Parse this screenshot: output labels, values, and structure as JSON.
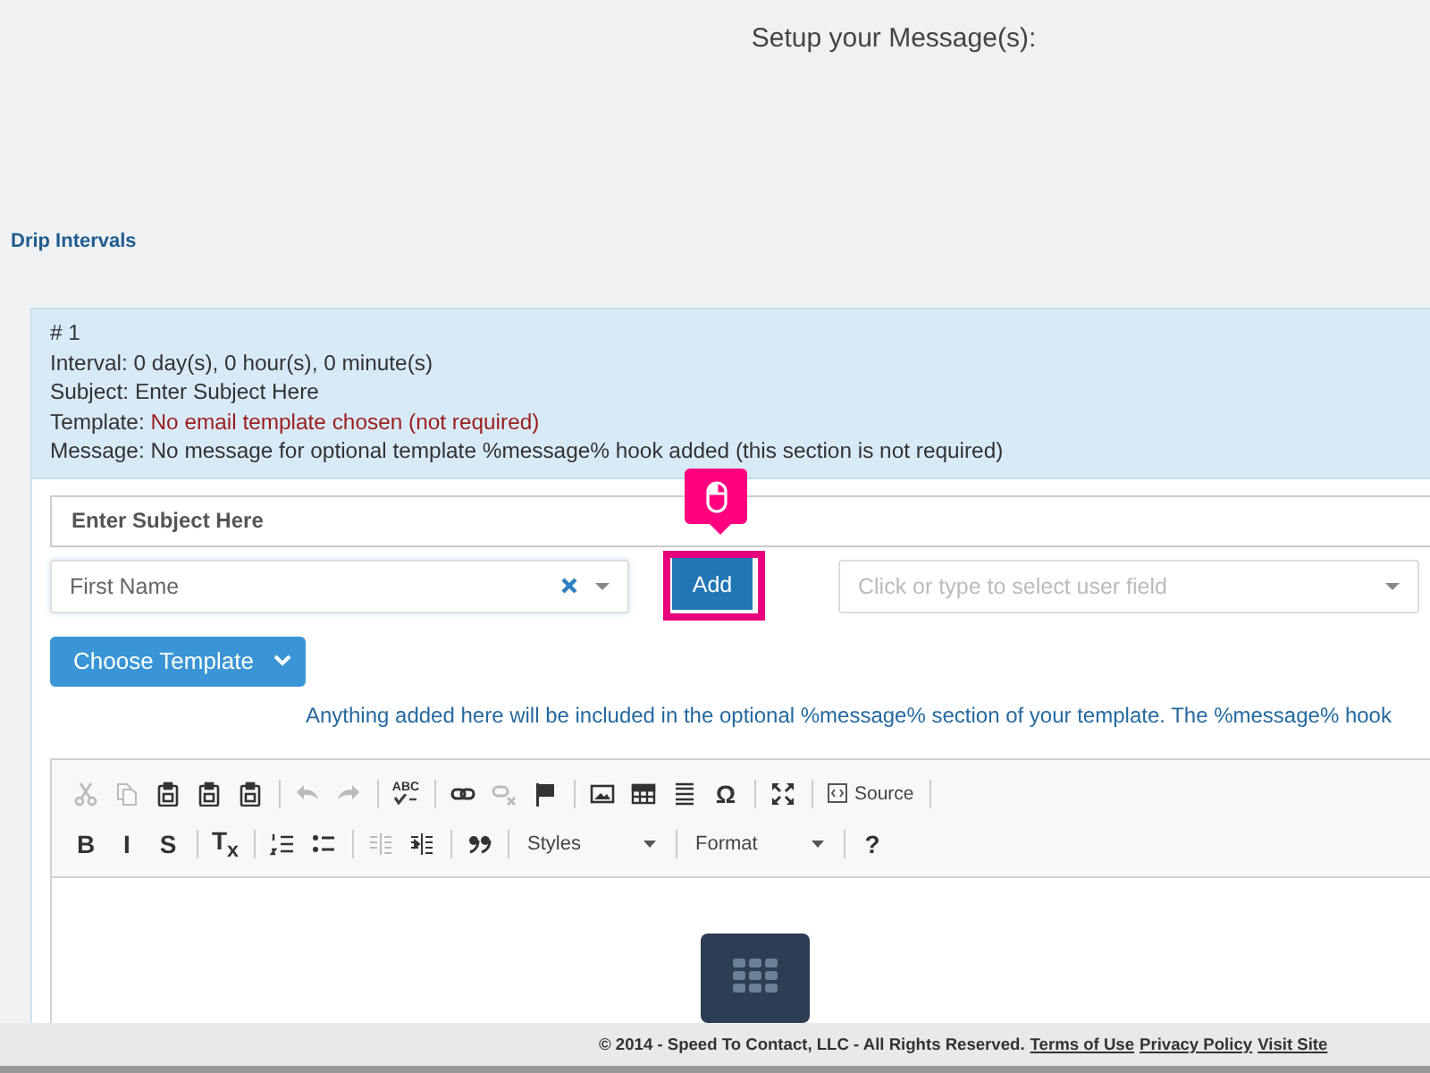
{
  "page_title": "Setup your Message(s):",
  "section_title": "Drip Intervals",
  "summary": {
    "number": "# 1",
    "lines": [
      {
        "label": "Interval:",
        "value": "0 day(s), 0 hour(s), 0 minute(s)",
        "kind": "plain"
      },
      {
        "label": "Subject:",
        "value": "Enter Subject Here",
        "kind": "plain"
      },
      {
        "label": "Template:",
        "value": "No email template chosen (not required)",
        "kind": "warning"
      },
      {
        "label": "Message:",
        "value": "No message for optional template %message% hook added (this section is not required)",
        "kind": "plain"
      }
    ]
  },
  "subject_field": {
    "value": "Enter Subject Here"
  },
  "merge_field_select": {
    "value": "First Name"
  },
  "add_button": {
    "label": "Add",
    "highlighted": true
  },
  "user_field_select": {
    "placeholder": "Click or type to select user field"
  },
  "template_button": {
    "label": "Choose Template"
  },
  "help_text": "Anything added here will be included in the optional %message% section of your template. The %message% hook",
  "editor": {
    "toolbar": [
      [
        {
          "kind": "button",
          "disabled": true
        },
        {
          "kind": "button",
          "disabled": true
        },
        {
          "kind": "button",
          "disabled": false
        },
        {
          "kind": "button",
          "disabled": false
        },
        {
          "kind": "button",
          "disabled": false
        },
        {
          "kind": "separator"
        },
        {
          "kind": "button",
          "disabled": true
        },
        {
          "kind": "button",
          "disabled": true
        },
        {
          "kind": "separator"
        },
        {
          "kind": "button",
          "glyph": "ABC",
          "disabled": false
        },
        {
          "kind": "separator"
        },
        {
          "kind": "button",
          "disabled": false
        },
        {
          "kind": "button",
          "disabled": true
        },
        {
          "kind": "button",
          "disabled": false
        },
        {
          "kind": "separator"
        },
        {
          "kind": "button",
          "disabled": false
        },
        {
          "kind": "button",
          "disabled": false
        },
        {
          "kind": "button",
          "disabled": false
        },
        {
          "kind": "button",
          "glyph": "Ω",
          "disabled": false
        },
        {
          "kind": "separator"
        },
        {
          "kind": "button",
          "disabled": false
        },
        {
          "kind": "separator"
        },
        {
          "kind": "source",
          "label": "Source"
        },
        {
          "kind": "separator"
        }
      ],
      [
        {
          "kind": "button",
          "glyph": "B",
          "disabled": false
        },
        {
          "kind": "button",
          "glyph": "I",
          "disabled": false
        },
        {
          "kind": "button",
          "glyph": "S",
          "disabled": false
        },
        {
          "kind": "separator"
        },
        {
          "kind": "button",
          "glyph": "T$_{x}$",
          "disabled": false
        },
        {
          "kind": "separator"
        },
        {
          "kind": "button",
          "disabled": false
        },
        {
          "kind": "button",
          "disabled": false
        },
        {
          "kind": "separator"
        },
        {
          "kind": "button",
          "disabled": true
        },
        {
          "kind": "button",
          "disabled": false
        },
        {
          "kind": "separator"
        },
        {
          "kind": "button",
          "disabled": false
        },
        {
          "kind": "separator"
        },
        {
          "kind": "dropdown",
          "label": "Styles"
        },
        {
          "kind": "separator"
        },
        {
          "kind": "dropdown",
          "label": "Format"
        },
        {
          "kind": "separator"
        },
        {
          "kind": "button",
          "glyph": "?",
          "disabled": false
        }
      ]
    ]
  },
  "footer": {
    "copyright": "© 2014 - Speed To Contact, LLC - All Rights Reserved.",
    "links": [
      "Terms of Use",
      "Privacy Policy",
      "Visit Site"
    ]
  }
}
